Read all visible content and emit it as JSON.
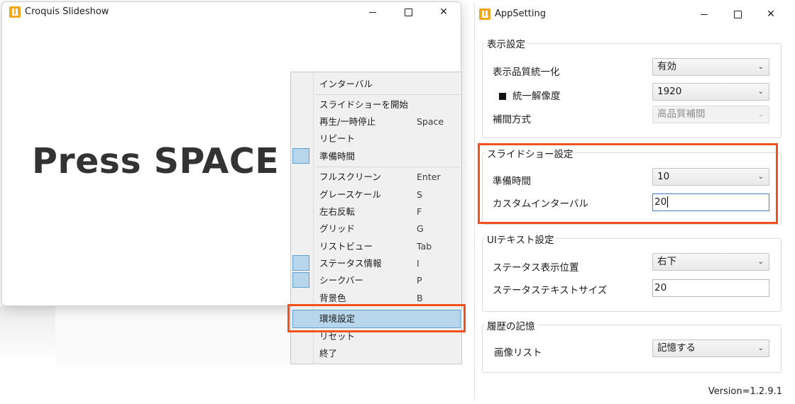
{
  "croquis": {
    "title": "Croquis Slideshow",
    "main_text": "Press SPACE"
  },
  "context_menu": {
    "items": [
      {
        "label": "インターバル",
        "key": ""
      },
      {
        "label": "スライドショーを開始",
        "key": ""
      },
      {
        "label": "再生/一時停止",
        "key": "Space"
      },
      {
        "label": "リピート",
        "key": ""
      },
      {
        "label": "準備時間",
        "key": ""
      },
      {
        "label": "フルスクリーン",
        "key": "Enter"
      },
      {
        "label": "グレースケール",
        "key": "S"
      },
      {
        "label": "左右反転",
        "key": "F"
      },
      {
        "label": "グリッド",
        "key": "G"
      },
      {
        "label": "リストビュー",
        "key": "Tab"
      },
      {
        "label": "ステータス情報",
        "key": "I"
      },
      {
        "label": "シークバー",
        "key": "P"
      },
      {
        "label": "背景色",
        "key": "B"
      },
      {
        "label": "環境設定",
        "key": ""
      },
      {
        "label": "リセット",
        "key": ""
      },
      {
        "label": "終了",
        "key": ""
      }
    ]
  },
  "settings": {
    "title": "AppSetting",
    "display": {
      "group_title": "表示設定",
      "unify_quality_label": "表示品質統一化",
      "unify_quality_value": "有効",
      "unify_resolution_label": "統一解像度",
      "unify_resolution_value": "1920",
      "interpolation_label": "補間方式",
      "interpolation_value": "高品質補間"
    },
    "slideshow": {
      "group_title": "スライドショー設定",
      "prep_time_label": "準備時間",
      "prep_time_value": "10",
      "custom_interval_label": "カスタムインターバル",
      "custom_interval_value": "20"
    },
    "ui_text": {
      "group_title": "UIテキスト設定",
      "status_position_label": "ステータス表示位置",
      "status_position_value": "右下",
      "status_text_size_label": "ステータステキストサイズ",
      "status_text_size_value": "20"
    },
    "history": {
      "group_title": "履歴の記憶",
      "image_list_label": "画像リスト",
      "image_list_value": "記憶する"
    },
    "version": "Version=1.2.9.1"
  },
  "colors": {
    "highlight_border": "#f1511b",
    "menu_selection": "#b8d6eb",
    "app_icon": "#f2a619"
  }
}
